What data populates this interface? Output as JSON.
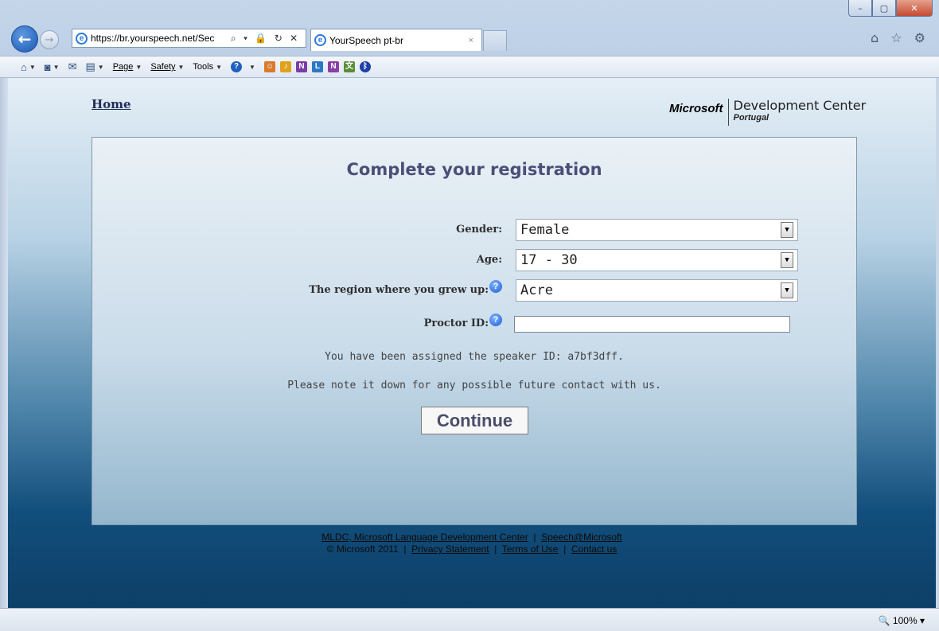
{
  "browser": {
    "address_url": "https://br.yourspeech.net/Sec",
    "address_icons": "⌕ ▾ 🔒 ↻ ✕",
    "tab_title": "YourSpeech pt-br",
    "tab_close": "×",
    "right_icons": "⌂ ☆ ⚙",
    "window_buttons": {
      "minimize": "–",
      "maximize": "▢",
      "close": "✕"
    },
    "back": "←",
    "forward": "→"
  },
  "command_bar": {
    "page": "Page",
    "safety": "Safety",
    "tools": "Tools"
  },
  "header": {
    "home_link": "Home",
    "logo_brand": "Microsoft",
    "logo_title": "Development Center",
    "logo_subtitle": "Portugal"
  },
  "form": {
    "heading": "Complete your registration",
    "gender_label": "Gender:",
    "gender_value": "Female",
    "age_label": "Age:",
    "age_value": "17 - 30",
    "region_label": "The region where you grew up:",
    "region_value": "Acre",
    "proctor_label": "Proctor ID:",
    "proctor_value": "",
    "speaker_id_text": "You have been assigned the speaker ID: a7bf3dff.",
    "note_text": "Please note it down for any possible future contact with us.",
    "continue_label": "Continue"
  },
  "footer": {
    "mldc_link": "MLDC, Microsoft Language Development Center",
    "speech_link": "Speech@Microsoft",
    "copyright": "© Microsoft 2011",
    "privacy_link": "Privacy Statement",
    "terms_link": "Terms of Use",
    "contact_link": "Contact us",
    "separator": "|"
  },
  "status": {
    "zoom": "100%"
  }
}
